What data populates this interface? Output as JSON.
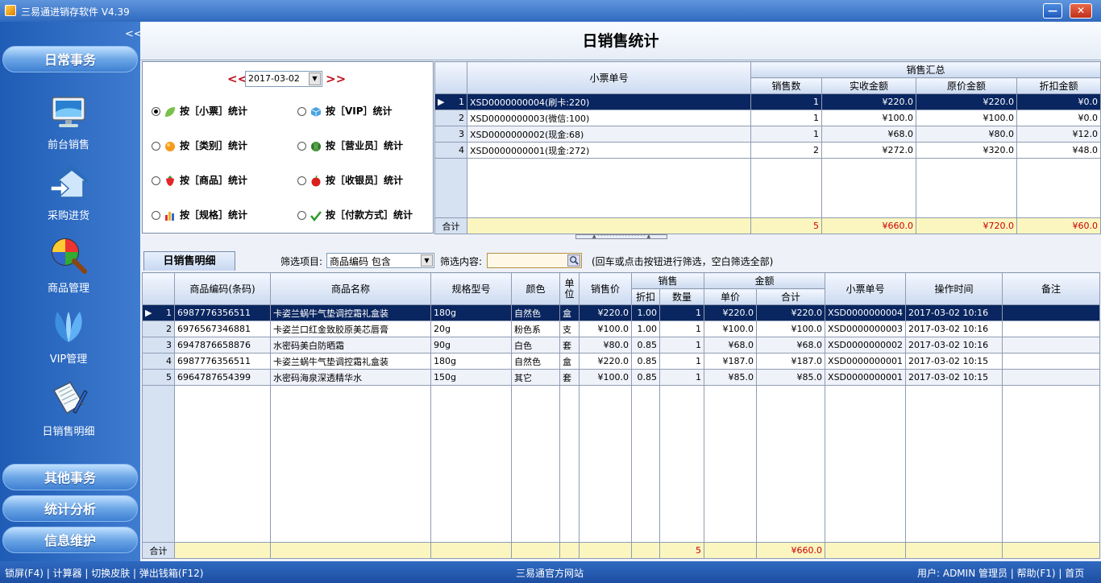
{
  "window": {
    "title": "三易通进销存软件 V4.39",
    "minimize_label": "—",
    "close_label": "✕"
  },
  "sidebar": {
    "collapse_label": "<<",
    "sections": {
      "daily": "日常事务",
      "other": "其他事务",
      "stats": "统计分析",
      "info": "信息维护"
    },
    "items": [
      {
        "label": "前台销售",
        "icon": "monitor-icon"
      },
      {
        "label": "采购进货",
        "icon": "house-arrow-icon"
      },
      {
        "label": "商品管理",
        "icon": "magnifier-color-icon"
      },
      {
        "label": "VIP管理",
        "icon": "vip-petal-icon"
      },
      {
        "label": "日销售明细",
        "icon": "document-pen-icon"
      }
    ]
  },
  "page": {
    "title": "日销售统计"
  },
  "date": {
    "prev": "<<",
    "value": "2017-03-02",
    "next": ">>",
    "dropdown_glyph": "▼"
  },
  "options": [
    {
      "label": "按［小票］统计",
      "selected": true,
      "icon": "leaf-icon"
    },
    {
      "label": "按［VIP］统计",
      "selected": false,
      "icon": "cube-icon"
    },
    {
      "label": "按［类别］统计",
      "selected": false,
      "icon": "orange-ball-icon"
    },
    {
      "label": "按［营业员］统计",
      "selected": false,
      "icon": "watermelon-icon"
    },
    {
      "label": "按［商品］统计",
      "selected": false,
      "icon": "strawberry-icon"
    },
    {
      "label": "按［收银员］统计",
      "selected": false,
      "icon": "apple-icon"
    },
    {
      "label": "按［规格］统计",
      "selected": false,
      "icon": "bar-chart-icon"
    },
    {
      "label": "按［付款方式］统计",
      "selected": false,
      "icon": "checkmark-icon"
    }
  ],
  "summary": {
    "headers": {
      "receipt": "小票单号",
      "group": "销售汇总",
      "qty": "销售数",
      "received": "实收金额",
      "original": "原价金额",
      "discount": "折扣金额"
    },
    "rows": [
      {
        "idx": "1",
        "receipt": "XSD0000000004(刷卡:220)",
        "qty": "1",
        "received": "¥220.0",
        "original": "¥220.0",
        "discount": "¥0.0"
      },
      {
        "idx": "2",
        "receipt": "XSD0000000003(微信:100)",
        "qty": "1",
        "received": "¥100.0",
        "original": "¥100.0",
        "discount": "¥0.0"
      },
      {
        "idx": "3",
        "receipt": "XSD0000000002(现金:68)",
        "qty": "1",
        "received": "¥68.0",
        "original": "¥80.0",
        "discount": "¥12.0"
      },
      {
        "idx": "4",
        "receipt": "XSD0000000001(现金:272)",
        "qty": "2",
        "received": "¥272.0",
        "original": "¥320.0",
        "discount": "¥48.0"
      }
    ],
    "total": {
      "label": "合计",
      "qty": "5",
      "received": "¥660.0",
      "original": "¥720.0",
      "discount": "¥60.0"
    }
  },
  "splitter": {
    "glyph": "▲ · · · · · · · · · · · · · · · · ▲"
  },
  "detail": {
    "tab_label": "日销售明细",
    "filter_label": "筛选项目:",
    "filter_value": "商品编码 包含",
    "filter_content_label": "筛选内容:",
    "filter_content_value": "",
    "filter_hint": "(回车或点击按钮进行筛选，空白筛选全部)",
    "headers": {
      "code": "商品编码(条码)",
      "name": "商品名称",
      "spec": "规格型号",
      "color": "颜色",
      "unit": "单位",
      "price": "销售价",
      "sale": "销售",
      "disc": "折扣",
      "qty": "数量",
      "amount": "金额",
      "unit_price": "单价",
      "subtotal": "合计",
      "receipt": "小票单号",
      "time": "操作时间",
      "note": "备注"
    },
    "rows": [
      {
        "idx": "1",
        "code": "6987776356511",
        "name": "卡姿兰蜗牛气垫调控霜礼盒装",
        "spec": "180g",
        "color": "自然色",
        "unit": "盒",
        "price": "¥220.0",
        "disc": "1.00",
        "qty": "1",
        "unit_price": "¥220.0",
        "subtotal": "¥220.0",
        "receipt": "XSD0000000004",
        "time": "2017-03-02 10:16",
        "note": ""
      },
      {
        "idx": "2",
        "code": "6976567346881",
        "name": "卡姿兰口红金致胶原美芯唇膏",
        "spec": "20g",
        "color": "粉色系",
        "unit": "支",
        "price": "¥100.0",
        "disc": "1.00",
        "qty": "1",
        "unit_price": "¥100.0",
        "subtotal": "¥100.0",
        "receipt": "XSD0000000003",
        "time": "2017-03-02 10:16",
        "note": ""
      },
      {
        "idx": "3",
        "code": "6947876658876",
        "name": "水密码美白防晒霜",
        "spec": "90g",
        "color": "白色",
        "unit": "套",
        "price": "¥80.0",
        "disc": "0.85",
        "qty": "1",
        "unit_price": "¥68.0",
        "subtotal": "¥68.0",
        "receipt": "XSD0000000002",
        "time": "2017-03-02 10:16",
        "note": ""
      },
      {
        "idx": "4",
        "code": "6987776356511",
        "name": "卡姿兰蜗牛气垫调控霜礼盒装",
        "spec": "180g",
        "color": "自然色",
        "unit": "盒",
        "price": "¥220.0",
        "disc": "0.85",
        "qty": "1",
        "unit_price": "¥187.0",
        "subtotal": "¥187.0",
        "receipt": "XSD0000000001",
        "time": "2017-03-02 10:15",
        "note": ""
      },
      {
        "idx": "5",
        "code": "6964787654399",
        "name": "水密码海泉深透精华水",
        "spec": "150g",
        "color": "其它",
        "unit": "套",
        "price": "¥100.0",
        "disc": "0.85",
        "qty": "1",
        "unit_price": "¥85.0",
        "subtotal": "¥85.0",
        "receipt": "XSD0000000001",
        "time": "2017-03-02 10:15",
        "note": ""
      }
    ],
    "total": {
      "label": "合计",
      "qty": "5",
      "subtotal": "¥660.0"
    }
  },
  "status": {
    "left": "锁屏(F4) | 计算器 | 切换皮肤 | 弹出钱箱(F12)",
    "center": "三易通官方网站",
    "right": "用户: ADMIN 管理员 | 帮助(F1) | 首页"
  }
}
